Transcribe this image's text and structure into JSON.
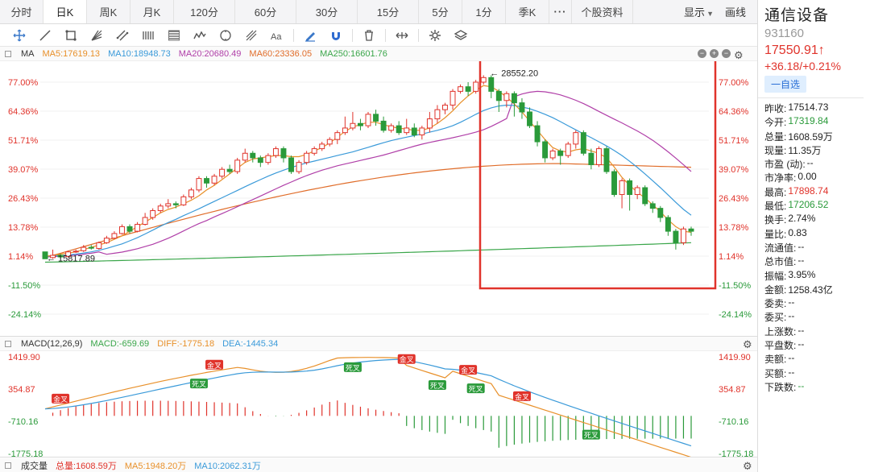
{
  "periods": [
    {
      "label": "分时",
      "active": false
    },
    {
      "label": "日K",
      "active": true
    },
    {
      "label": "周K",
      "active": false
    },
    {
      "label": "月K",
      "active": false
    },
    {
      "label": "120分",
      "active": false
    },
    {
      "label": "60分",
      "active": false
    },
    {
      "label": "30分",
      "active": false
    },
    {
      "label": "15分",
      "active": false
    },
    {
      "label": "5分",
      "active": false
    },
    {
      "label": "1分",
      "active": false
    },
    {
      "label": "季K",
      "active": false
    }
  ],
  "more_dots": "···",
  "profile_tab": "个股资料",
  "toolbar_right": {
    "display": "显示",
    "draw": "画线"
  },
  "tools": [
    "crosshair-icon",
    "line-icon",
    "rect-icon",
    "fan-icon",
    "parallel-icon",
    "bars-icon",
    "list-icon",
    "wave-icon",
    "cycle-icon",
    "fork-icon",
    "text-icon",
    "pen-icon",
    "magnet-icon",
    "trash-icon",
    "resize-icon",
    "settings-icon",
    "layers-icon"
  ],
  "ma_legend": {
    "name": "MA",
    "items": [
      {
        "text": "MA5:17619.13",
        "color": "#e8902a"
      },
      {
        "text": "MA10:18948.73",
        "color": "#3a9ad9"
      },
      {
        "text": "MA20:20680.49",
        "color": "#b03fa8"
      },
      {
        "text": "MA60:23336.05",
        "color": "#e06d2a"
      },
      {
        "text": "MA250:16601.76",
        "color": "#3aa64a"
      }
    ]
  },
  "macd_legend": {
    "name": "MACD(12,26,9)",
    "items": [
      {
        "text": "MACD:-659.69",
        "color": "#3aa64a"
      },
      {
        "text": "DIFF:-1775.18",
        "color": "#e8902a"
      },
      {
        "text": "DEA:-1445.34",
        "color": "#3a9ad9"
      }
    ]
  },
  "volume_legend": {
    "name": "成交量",
    "items": [
      {
        "text": "总量:1608.59万",
        "color": "#e0332b"
      },
      {
        "text": "MA5:1948.20万",
        "color": "#e8902a"
      },
      {
        "text": "MA10:2062.31万",
        "color": "#3a9ad9"
      }
    ]
  },
  "main_axis_labels": [
    "77.00%",
    "64.36%",
    "51.71%",
    "39.07%",
    "26.43%",
    "13.78%",
    "1.14%",
    "-11.50%",
    "-24.14%"
  ],
  "macd_axis_labels": [
    "1419.90",
    "354.87",
    "-710.16",
    "-1775.18"
  ],
  "annotations": {
    "high": "28552.20",
    "low": "15817.89"
  },
  "macd_signals": {
    "golden": "金叉",
    "dead": "死叉"
  },
  "colors": {
    "up": "#e0332b",
    "down": "#2a9a3a",
    "highlight_box": "#e0332b"
  },
  "chart_data": {
    "type": "candlestick",
    "y_axis": "percent change",
    "ylim": [
      -24.14,
      77.0
    ],
    "candles": [
      [
        3,
        0,
        0.5,
        1
      ],
      [
        0.5,
        1.5,
        4,
        0
      ],
      [
        1.5,
        0.8,
        2.2,
        0
      ],
      [
        1,
        3,
        3.5,
        0.5
      ],
      [
        3,
        3.3,
        4,
        2.5
      ],
      [
        3.5,
        5,
        6,
        3
      ],
      [
        5,
        4.6,
        6,
        4
      ],
      [
        4.5,
        7,
        7.5,
        4
      ],
      [
        7,
        9,
        10,
        6.5
      ],
      [
        9,
        11,
        12,
        8.5
      ],
      [
        11,
        14,
        15,
        10.5
      ],
      [
        14,
        12,
        15,
        11
      ],
      [
        12,
        15,
        16,
        11.5
      ],
      [
        15,
        18,
        20,
        14.5
      ],
      [
        18,
        21,
        22,
        17
      ],
      [
        21,
        23,
        24,
        20
      ],
      [
        23,
        24,
        26,
        22
      ],
      [
        24,
        23.5,
        25,
        22
      ],
      [
        23.5,
        27,
        28,
        23
      ],
      [
        27,
        30,
        31,
        26
      ],
      [
        30,
        35,
        36,
        29
      ],
      [
        35,
        33,
        36,
        31
      ],
      [
        33,
        36,
        37,
        32
      ],
      [
        36,
        39,
        40,
        35
      ],
      [
        39,
        38,
        41,
        37
      ],
      [
        38,
        43,
        44,
        37
      ],
      [
        43,
        46,
        48,
        42
      ],
      [
        46,
        44,
        47,
        42
      ],
      [
        44,
        42,
        45,
        40
      ],
      [
        42,
        45,
        46,
        41
      ],
      [
        45,
        48,
        49,
        44
      ],
      [
        48,
        44,
        49,
        42
      ],
      [
        44,
        38,
        45,
        37
      ],
      [
        38,
        42,
        43,
        37
      ],
      [
        42,
        46,
        47,
        41
      ],
      [
        46,
        48,
        49,
        45
      ],
      [
        48,
        50,
        51,
        47
      ],
      [
        50,
        52,
        53,
        49
      ],
      [
        52,
        55,
        56,
        50
      ],
      [
        55,
        57,
        62,
        54
      ],
      [
        57,
        59,
        64,
        56
      ],
      [
        59,
        58,
        61,
        56
      ],
      [
        58,
        63,
        64,
        57
      ],
      [
        63,
        60,
        65,
        58
      ],
      [
        60,
        56,
        62,
        55
      ],
      [
        56,
        58,
        59,
        55
      ],
      [
        58,
        55,
        60,
        54
      ],
      [
        55,
        57,
        61,
        54
      ],
      [
        57,
        54,
        59,
        53
      ],
      [
        54,
        57,
        58,
        52
      ],
      [
        57,
        61,
        64,
        55
      ],
      [
        61,
        65,
        67,
        59
      ],
      [
        65,
        67,
        68,
        63
      ],
      [
        67,
        73,
        74,
        65
      ],
      [
        73,
        75,
        76,
        72
      ],
      [
        75,
        73,
        77,
        71
      ],
      [
        73,
        77,
        78,
        72
      ],
      [
        77,
        79,
        80,
        76
      ],
      [
        79,
        73,
        80,
        70
      ],
      [
        73,
        69,
        74,
        64
      ],
      [
        69,
        72,
        73,
        66
      ],
      [
        72,
        68,
        73,
        62
      ],
      [
        68,
        64,
        70,
        61
      ],
      [
        64,
        58,
        66,
        57
      ],
      [
        58,
        51,
        60,
        49
      ],
      [
        51,
        44,
        52,
        42
      ],
      [
        44,
        47,
        48,
        43
      ],
      [
        47,
        45,
        48,
        41
      ],
      [
        45,
        50,
        51,
        44
      ],
      [
        50,
        55,
        56,
        48
      ],
      [
        55,
        46,
        56,
        45
      ],
      [
        46,
        41,
        48,
        39
      ],
      [
        41,
        48,
        49,
        40
      ],
      [
        48,
        38,
        49,
        37
      ],
      [
        38,
        28,
        39,
        27
      ],
      [
        28,
        34,
        35,
        22
      ],
      [
        34,
        28,
        35,
        21
      ],
      [
        28,
        31,
        32,
        26
      ],
      [
        31,
        24,
        32,
        23
      ],
      [
        24,
        22,
        25,
        20
      ],
      [
        22,
        18,
        23,
        16
      ],
      [
        18,
        12,
        19,
        10
      ],
      [
        12,
        7,
        13,
        4
      ],
      [
        7,
        13,
        14,
        6
      ],
      [
        13,
        12,
        14,
        10
      ]
    ],
    "ma5": [
      1,
      1.5,
      2,
      2.5,
      3,
      4,
      5,
      6,
      7,
      8.5,
      10,
      12,
      14,
      16,
      18,
      20,
      21.5,
      22.5,
      24,
      25.5,
      27.5,
      30,
      32,
      34.5,
      37,
      39.5,
      42,
      43.5,
      44,
      44.5,
      45,
      45,
      44.5,
      44.5,
      45.5,
      47,
      48.5,
      50.5,
      53,
      55.5,
      57.5,
      58.5,
      59.5,
      59.5,
      58.5,
      57.5,
      57,
      56.5,
      56,
      56,
      57,
      59,
      61.5,
      64.5,
      68,
      71,
      73.5,
      75.5,
      75,
      73,
      70.5,
      67.5,
      64,
      60,
      56,
      52,
      48.5,
      47,
      46.5,
      47.5,
      48,
      47,
      46,
      44,
      40,
      35.5,
      32,
      29,
      26.5,
      23.5,
      20.5,
      17,
      14,
      12,
      11.5
    ],
    "ma10": [
      1,
      1.2,
      1.4,
      1.7,
      2,
      2.5,
      3,
      3.7,
      4.5,
      5.5,
      6.5,
      7.8,
      9.2,
      10.8,
      12.5,
      14.2,
      15.8,
      17.2,
      18.8,
      20.3,
      21.8,
      23.4,
      25,
      26.6,
      28.2,
      29.8,
      31.4,
      33,
      34.5,
      36,
      37.4,
      38.6,
      39.8,
      40.8,
      41.8,
      42.6,
      43.4,
      44.2,
      45,
      45.8,
      46.6,
      47.6,
      48.6,
      49.6,
      50.6,
      51.5,
      52.3,
      53,
      53.7,
      54.4,
      55.2,
      56,
      56.9,
      58,
      59.5,
      61.2,
      63,
      64.6,
      65.8,
      66.6,
      67,
      66.8,
      66.2,
      65.4,
      64.3,
      63,
      61.5,
      59.8,
      58,
      56.2,
      54.5,
      52.8,
      51,
      49.2,
      47.2,
      45,
      42.5,
      39.8,
      37,
      34,
      31,
      27.8,
      24.6,
      21.5,
      19
    ]
  }
}
